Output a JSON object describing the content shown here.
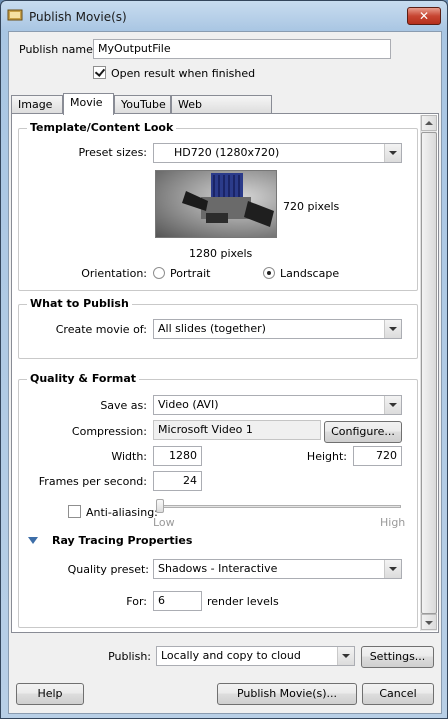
{
  "window": {
    "title": "Publish Movie(s)",
    "close_label": "✕"
  },
  "publish_name": {
    "label": "Publish name:",
    "value": "MyOutputFile"
  },
  "open_result": {
    "label": "Open result when finished",
    "checked": true
  },
  "tabs": [
    {
      "label": "Image"
    },
    {
      "label": "Movie",
      "active": true
    },
    {
      "label": "YouTube"
    },
    {
      "label": "Web Presentation"
    }
  ],
  "template": {
    "title": "Template/Content Look",
    "preset_label": "Preset sizes:",
    "preset_value": "HD720 (1280x720)",
    "height_px": "720 pixels",
    "width_px": "1280 pixels",
    "orientation_label": "Orientation:",
    "portrait_label": "Portrait",
    "landscape_label": "Landscape",
    "selected_orientation": "Landscape"
  },
  "what_to_publish": {
    "title": "What to Publish",
    "create_label": "Create movie of:",
    "create_value": "All slides (together)"
  },
  "quality": {
    "title": "Quality & Format",
    "save_as_label": "Save as:",
    "save_as_value": "Video (AVI)",
    "compression_label": "Compression:",
    "compression_value": "Microsoft Video 1",
    "configure_label": "Configure...",
    "width_label": "Width:",
    "width_value": "1280",
    "height_label": "Height:",
    "height_value": "720",
    "fps_label": "Frames per second:",
    "fps_value": "24",
    "antialias_label": "Anti-aliasing:",
    "antialias_checked": false,
    "low_label": "Low",
    "high_label": "High",
    "ray_tracing_title": "Ray Tracing Properties",
    "quality_preset_label": "Quality preset:",
    "quality_preset_value": "Shadows - Interactive",
    "for_label": "For:",
    "for_value": "6",
    "render_levels_label": "render levels"
  },
  "publish": {
    "label": "Publish:",
    "value": "Locally and copy to cloud",
    "settings_label": "Settings..."
  },
  "footer": {
    "help_label": "Help",
    "publish_label": "Publish Movie(s)...",
    "cancel_label": "Cancel"
  }
}
